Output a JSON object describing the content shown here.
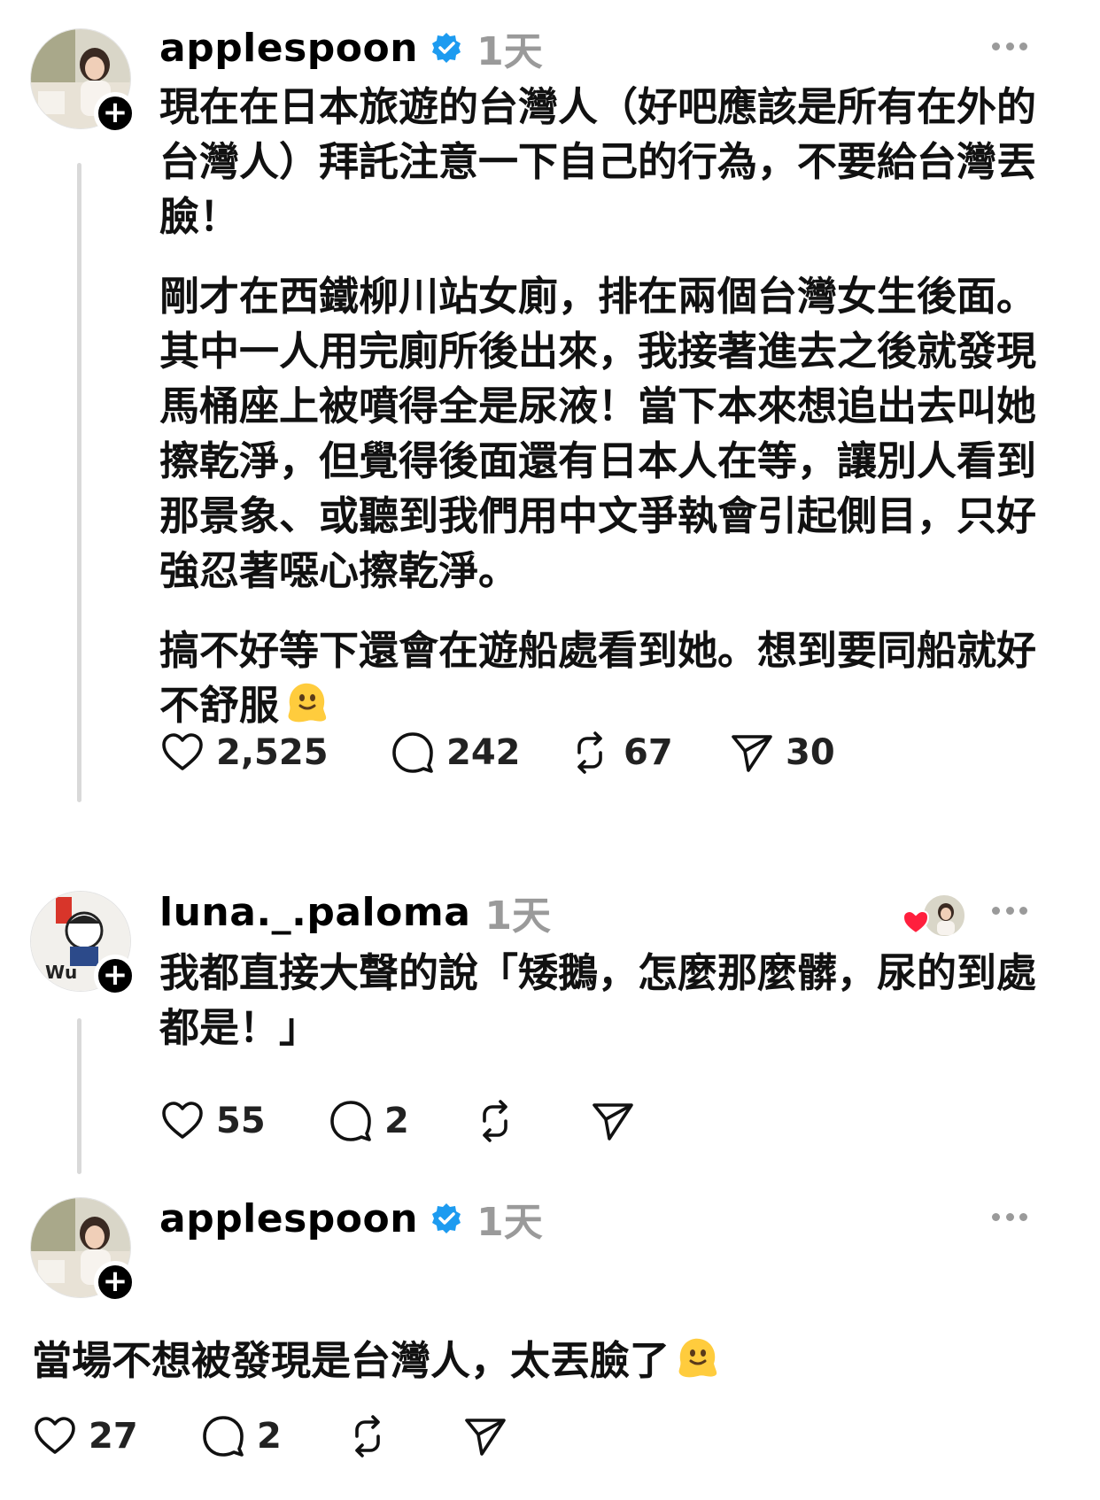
{
  "posts": [
    {
      "username": "applespoon",
      "time": "1天",
      "paragraphs": [
        "現在在日本旅遊的台灣人（好吧應該是所有在外的台灣人）拜託注意一下自己的行為，不要給台灣丟臉！",
        "剛才在西鐵柳川站女廁，排在兩個台灣女生後面。其中一人用完廁所後出來，我接著進去之後就發現馬桶座上被噴得全是尿液！當下本來想追出去叫她擦乾淨，但覺得後面還有日本人在等，讓別人看到那景象、或聽到我們用中文爭執會引起側目，只好強忍著噁心擦乾淨。",
        "搞不好等下還會在遊船處看到她。想到要同船就好不舒服"
      ],
      "likes": "2,525",
      "comments": "242",
      "reposts": "67",
      "shares": "30"
    },
    {
      "username": "luna._.paloma",
      "time": "1天",
      "paragraphs": [
        "我都直接大聲的說「矮鵝，怎麼那麼髒，尿的到處都是！」"
      ],
      "likes": "55",
      "comments": "2"
    },
    {
      "username": "applespoon",
      "time": "1天",
      "paragraphs": [
        "當場不想被發現是台灣人，太丟臉了"
      ],
      "likes": "27",
      "comments": "2"
    }
  ],
  "icons": {
    "verified": "verified-badge-icon",
    "like": "heart-icon",
    "comment": "comment-bubble-icon",
    "repost": "repost-icon",
    "share": "send-icon",
    "more": "more-dots-icon",
    "emoji": "melting-face-emoji"
  },
  "colors": {
    "verified": "#1d9bf0",
    "muted": "#9a9a9a",
    "heart": "#ff1f3d"
  }
}
